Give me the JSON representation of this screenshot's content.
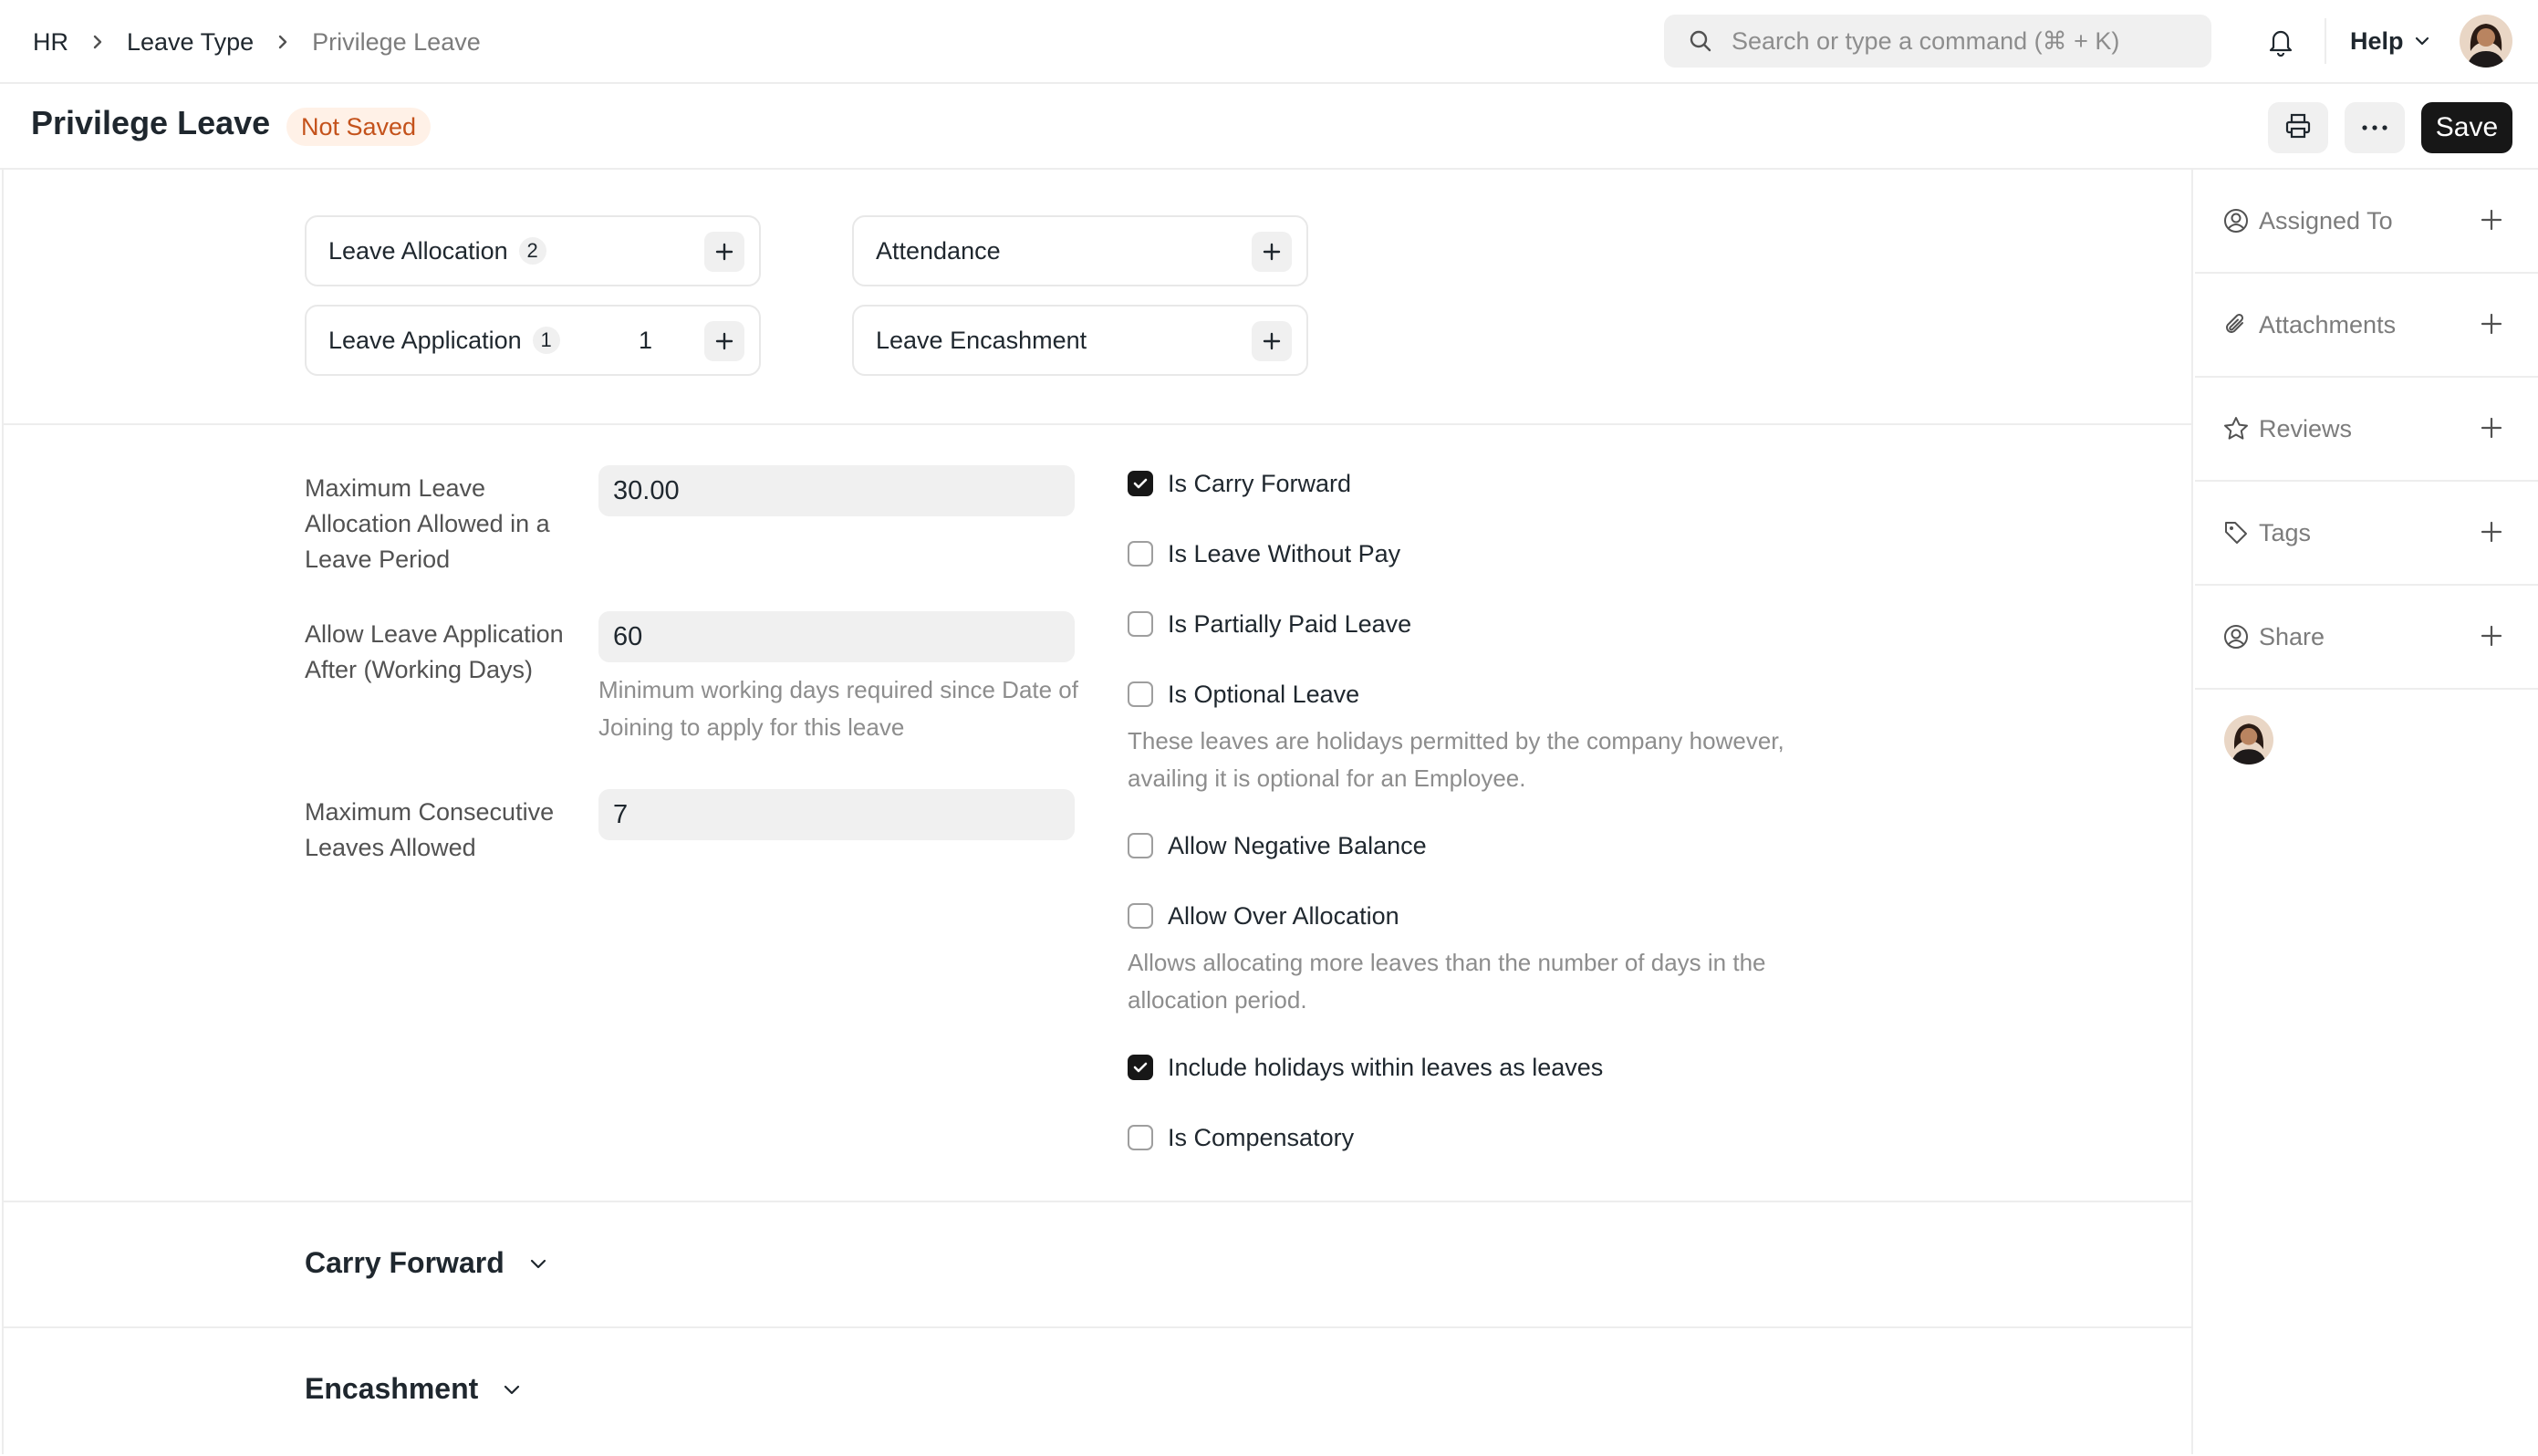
{
  "navbar": {
    "breadcrumbs": [
      "HR",
      "Leave Type",
      "Privilege Leave"
    ],
    "search_placeholder": "Search or type a command (⌘ + K)",
    "help_label": "Help"
  },
  "page": {
    "title": "Privilege Leave",
    "status": "Not Saved",
    "save_label": "Save"
  },
  "connections": [
    {
      "label": "Leave Allocation",
      "count": "2",
      "open": ""
    },
    {
      "label": "Attendance",
      "count": "",
      "open": ""
    },
    {
      "label": "Leave Application",
      "count": "1",
      "open": "1"
    },
    {
      "label": "Leave Encashment",
      "count": "",
      "open": ""
    }
  ],
  "fields": {
    "max_allocation": {
      "label": "Maximum Leave Allocation Allowed in a Leave Period",
      "value": "30.00"
    },
    "applicable_after": {
      "label": "Allow Leave Application After (Working Days)",
      "value": "60",
      "help": "Minimum working days required since Date of Joining to apply for this leave"
    },
    "max_consecutive": {
      "label": "Maximum Consecutive Leaves Allowed",
      "value": "7"
    }
  },
  "checkboxes": [
    {
      "label": "Is Carry Forward",
      "checked": true
    },
    {
      "label": "Is Leave Without Pay",
      "checked": false
    },
    {
      "label": "Is Partially Paid Leave",
      "checked": false
    },
    {
      "label": "Is Optional Leave",
      "checked": false,
      "help": "These leaves are holidays permitted by the company however, availing it is optional for an Employee."
    },
    {
      "label": "Allow Negative Balance",
      "checked": false
    },
    {
      "label": "Allow Over Allocation",
      "checked": false,
      "help": "Allows allocating more leaves than the number of days in the allocation period."
    },
    {
      "label": "Include holidays within leaves as leaves",
      "checked": true
    },
    {
      "label": "Is Compensatory",
      "checked": false
    }
  ],
  "sections": {
    "carry_forward": "Carry Forward",
    "encashment": "Encashment"
  },
  "sidebar": {
    "items": [
      {
        "label": "Assigned To",
        "icon": "assign-icon"
      },
      {
        "label": "Attachments",
        "icon": "paperclip-icon"
      },
      {
        "label": "Reviews",
        "icon": "star-icon"
      },
      {
        "label": "Tags",
        "icon": "tag-icon"
      },
      {
        "label": "Share",
        "icon": "share-user-icon"
      }
    ]
  },
  "colors": {
    "accent_dark": "#171717",
    "status_badge_bg": "#fff1e7",
    "status_badge_text": "#c4521b"
  }
}
